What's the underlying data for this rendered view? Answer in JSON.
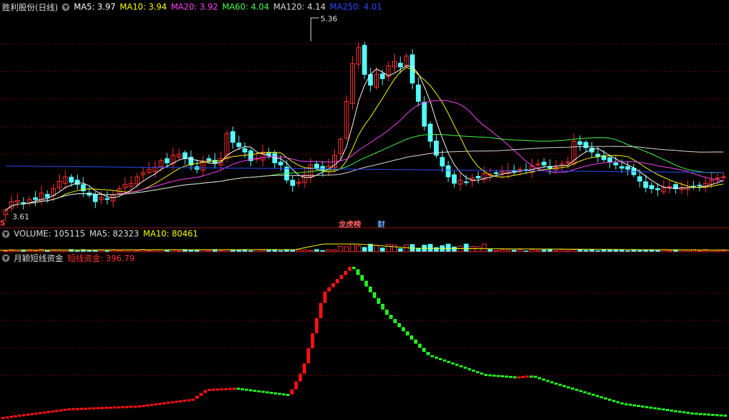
{
  "price_header": {
    "title": "胜利股份(日线)",
    "indicators": [
      {
        "label": "MA5: 3.97",
        "color": "#ffffff"
      },
      {
        "label": "MA10: 3.94",
        "color": "#ffff00"
      },
      {
        "label": "MA20: 3.92",
        "color": "#ff44ff"
      },
      {
        "label": "MA60: 4.04",
        "color": "#44ff44"
      },
      {
        "label": "MA120: 4.14",
        "color": "#dddddd"
      },
      {
        "label": "MA250: 4.01",
        "color": "#2a4cff"
      }
    ]
  },
  "price_annotations": {
    "high_label": "5.36",
    "low_label": "3.61",
    "event_1": "龙虎榜",
    "event_2": "财"
  },
  "volume_header": {
    "title": "VOLUME: 105115",
    "ma5": "MA5: 82323",
    "ma10": "MA10: 80461"
  },
  "fund_header": {
    "title": "月颖短线资金",
    "series_label": "短线资金: 396.79"
  },
  "colors": {
    "up": "#ff3030",
    "down": "#54ffff",
    "fund_up": "#ff1010",
    "fund_down": "#22ee22",
    "grid": "#7a0000"
  },
  "chart_data": [
    {
      "type": "candlestick",
      "title": "胜利股份(日线)",
      "ylim": [
        3.55,
        5.45
      ],
      "annotated_high": 5.36,
      "annotated_low": 3.61,
      "closes": [
        3.64,
        3.72,
        3.73,
        3.7,
        3.74,
        3.74,
        3.8,
        3.76,
        3.84,
        3.91,
        3.95,
        3.9,
        3.88,
        3.82,
        3.78,
        3.72,
        3.76,
        3.74,
        3.78,
        3.84,
        3.88,
        3.89,
        3.95,
        3.99,
        4.02,
        4.04,
        4.1,
        4.08,
        4.15,
        4.16,
        4.12,
        4.06,
        4.02,
        4.1,
        4.1,
        4.08,
        4.12,
        4.35,
        4.27,
        4.23,
        4.18,
        4.1,
        4.12,
        4.18,
        4.15,
        4.08,
        4.06,
        3.92,
        3.87,
        3.9,
        3.97,
        4.06,
        4.03,
        4.01,
        4.05,
        4.15,
        4.3,
        4.65,
        5.0,
        5.15,
        4.9,
        4.8,
        4.9,
        4.86,
        4.98,
        5.02,
        4.97,
        5.07,
        4.82,
        4.65,
        4.42,
        4.28,
        4.15,
        4.05,
        3.95,
        3.89,
        3.92,
        3.9,
        3.94,
        3.94,
        3.98,
        3.97,
        3.98,
        4.0,
        4.01,
        4.0,
        4.02,
        4.01,
        4.05,
        4.07,
        4.06,
        4.03,
        4.04,
        4.07,
        4.09,
        4.28,
        4.25,
        4.22,
        4.18,
        4.14,
        4.11,
        4.09,
        4.06,
        4.03,
        4.02,
        3.97,
        3.91,
        3.85,
        3.84,
        3.83,
        3.85,
        3.86,
        3.84,
        3.85,
        3.85,
        3.86,
        3.87,
        3.89,
        3.92,
        3.94,
        3.95
      ]
    },
    {
      "type": "line",
      "title": "月颖短线资金",
      "series": [
        {
          "name": "短线资金",
          "last": 396.79
        }
      ]
    }
  ]
}
